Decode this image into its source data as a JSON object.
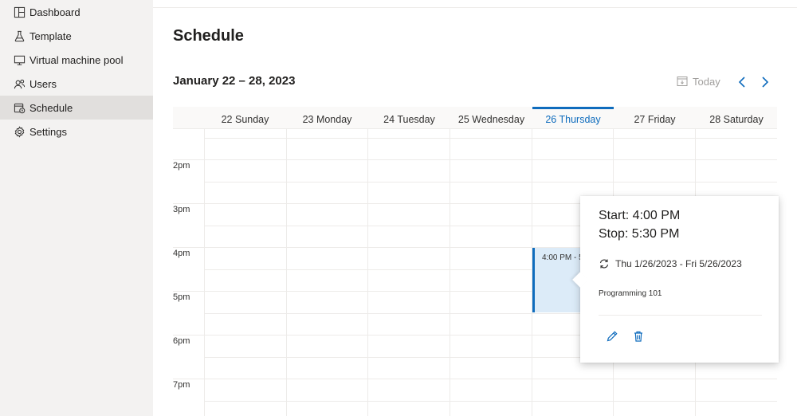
{
  "sidebar": {
    "items": [
      {
        "label": "Dashboard",
        "icon": "dashboard-icon"
      },
      {
        "label": "Template",
        "icon": "flask-icon"
      },
      {
        "label": "Virtual machine pool",
        "icon": "monitor-icon"
      },
      {
        "label": "Users",
        "icon": "users-icon"
      },
      {
        "label": "Schedule",
        "icon": "calendar-clock-icon",
        "active": true
      },
      {
        "label": "Settings",
        "icon": "gear-icon"
      }
    ]
  },
  "main": {
    "title": "Schedule",
    "week_range": "January 22 – 28, 2023",
    "today_label": "Today",
    "days": [
      "22 Sunday",
      "23 Monday",
      "24 Tuesday",
      "25 Wednesday",
      "26 Thursday",
      "27 Friday",
      "28 Saturday"
    ],
    "current_day_index": 4,
    "time_labels": [
      "2pm",
      "3pm",
      "4pm",
      "5pm",
      "6pm",
      "7pm"
    ]
  },
  "event": {
    "label": "4:00 PM - 5"
  },
  "popup": {
    "start": "Start: 4:00 PM",
    "stop": "Stop: 5:30 PM",
    "recurrence": "Thu 1/26/2023 - Fri 5/26/2023",
    "subject": "Programming 101"
  },
  "colors": {
    "accent": "#0f6cbd",
    "sidebar_bg": "#f3f2f1",
    "sidebar_active": "#e1dfdd",
    "event_bg": "#dcebf8"
  }
}
